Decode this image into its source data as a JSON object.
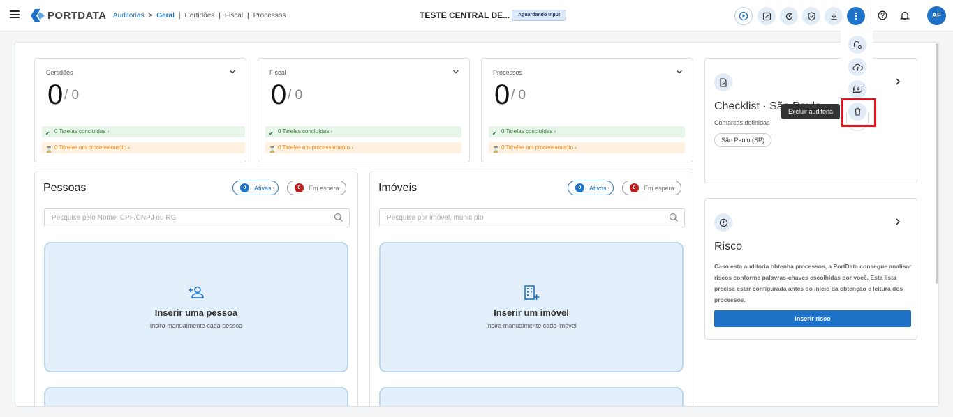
{
  "header": {
    "logo_text": "PORTDATA",
    "breadcrumb": {
      "root": "Auditorias",
      "arrow": ">",
      "active": "Geral",
      "items": [
        "Certidões",
        "Fiscal",
        "Processos"
      ],
      "separator": "|"
    },
    "title": "TESTE CENTRAL DE...",
    "status": "Aguardando Input",
    "avatar_initials": "AF",
    "icons": [
      "play-icon",
      "edit-icon",
      "refresh-icon",
      "shield-check-icon",
      "download-icon",
      "more-vert-icon",
      "help-icon",
      "bell-icon"
    ]
  },
  "stats": [
    {
      "label": "Certidões",
      "count": "0",
      "total": "/ 0",
      "done": "0 Tarefas concluídas",
      "processing": "0 Tarefas em processamento"
    },
    {
      "label": "Fiscal",
      "count": "0",
      "total": "/ 0",
      "done": "0 Tarefas concluídas",
      "processing": "0 Tarefas em processamento"
    },
    {
      "label": "Processos",
      "count": "0",
      "total": "/ 0",
      "done": "0 Tarefas concluídas",
      "processing": "0 Tarefas em processamento"
    }
  ],
  "pessoas": {
    "title": "Pessoas",
    "active_count": "0",
    "active_label": "Ativas",
    "waiting_count": "0",
    "waiting_label": "Em espera",
    "search_placeholder": "Pesquise pelo Nome, CPF/CNPJ ou RG",
    "insert_title": "Inserir uma pessoa",
    "insert_subtitle": "Insira manualmente cada pessoa"
  },
  "imoveis": {
    "title": "Imóveis",
    "active_count": "0",
    "active_label": "Ativos",
    "waiting_count": "0",
    "waiting_label": "Em espera",
    "search_placeholder": "Pesquise por imóvel, município",
    "insert_title": "Inserir um imóvel",
    "insert_subtitle": "Insira manualmente cada imóvel"
  },
  "checklist": {
    "title": "Checklist · São Paulo",
    "subtitle": "Comarcas definidas",
    "region": "São Paulo (SP)"
  },
  "risco": {
    "title": "Risco",
    "description": "Caso esta auditoria obtenha processos, a PortData consegue analisar riscos conforme palavras-chaves escolhidas por você. Esta lista precisa estar configurada antes do início da obtenção e leitura dos processos.",
    "button": "Inserir risco"
  },
  "dropdown_menu": {
    "tooltip": "Excluir auditoria",
    "items": [
      "bell-settings-icon",
      "cloud-upload-icon",
      "money-icon",
      "trash-icon"
    ]
  },
  "colors": {
    "accent": "#1e73c8",
    "accent_light": "#e2ecf7",
    "highlight": "#e0141a",
    "success": "#2e7d32",
    "warning": "#e58a1c",
    "danger": "#b71c1c"
  }
}
